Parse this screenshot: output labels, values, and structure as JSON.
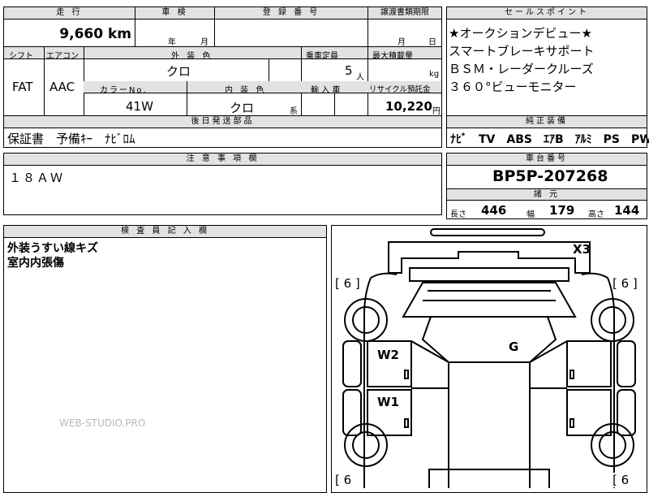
{
  "top_headers": {
    "mileage": "走 行",
    "inspection": "車 検",
    "registration": "登 録 番 号",
    "transfer_deadline": "譲渡書類期限",
    "sales_point": "セールスポイント"
  },
  "mileage_value": "9,660 km",
  "inspection_year": "年",
  "inspection_month": "月",
  "transfer_month": "月",
  "transfer_day": "日",
  "row2_headers": {
    "shift": "シフト",
    "aircon": "エアコン",
    "exterior_color": "外 装 色",
    "capacity": "乗車定員",
    "max_load": "最大積載量"
  },
  "shift_value": "FAT",
  "aircon_value": "AAC",
  "exterior_color_value": "クロ",
  "capacity_value": "5",
  "capacity_unit": "人",
  "max_load_unit": "kg",
  "row3_headers": {
    "color_no": "カラーNo.",
    "interior_color": "内 装 色",
    "import": "輸 入 車",
    "recycle": "リサイクル預託金"
  },
  "color_no_value": "41W",
  "interior_color_value": "クロ",
  "interior_suffix": "系",
  "recycle_value": "10,220",
  "recycle_unit": "円",
  "sales_points": [
    "★オークションデビュー★",
    "スマートブレーキサポート",
    "ＢＳＭ・レーダークルーズ",
    "３６０°ビューモニター"
  ],
  "later_parts_header": "後日発送部品",
  "later_parts_value": "保証書　予備ｷｰ　ﾅﾋﾞﾛﾑ",
  "genuine_equipment_header": "純正装備",
  "genuine_equipment_value": "ﾅﾋﾞ　TV　ABS　ｴｱB　ｱﾙﾐ　PS　PW",
  "notes_header": "注 意 事 項 欄",
  "notes_value": "１８ＡＷ",
  "chassis_header": "車台番号",
  "chassis_value": "BP5P-207268",
  "specs_header": "諸 元",
  "specs": {
    "length_label": "長さ",
    "length_value": "446",
    "width_label": "幅",
    "width_value": "179",
    "height_label": "高さ",
    "height_value": "144"
  },
  "inspector_header": "検 査 員 記 入 欄",
  "inspector_lines": [
    "外装うすい線キズ",
    "室内内張傷"
  ],
  "watermark": "WEB-STUDIO.PRO",
  "diagram": {
    "x3": "X3",
    "w2": "W2",
    "w1": "W1",
    "g": "G",
    "tire_left_top": "[ 6 ]",
    "tire_right_top": "[ 6 ]",
    "tire_left_bottom": "[ 6",
    "tire_right_bottom": "[ 6"
  }
}
